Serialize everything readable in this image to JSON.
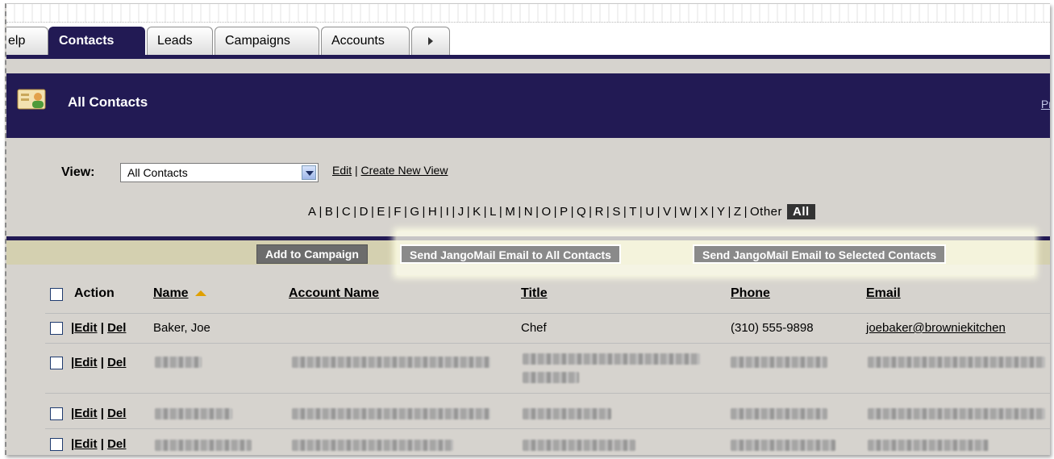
{
  "tabs": [
    {
      "label": "elp",
      "active": false
    },
    {
      "label": "Contacts",
      "active": true
    },
    {
      "label": "Leads",
      "active": false
    },
    {
      "label": "Campaigns",
      "active": false
    },
    {
      "label": "Accounts",
      "active": false
    }
  ],
  "header": {
    "title": "All Contacts",
    "right_link": "Pri"
  },
  "view": {
    "label": "View:",
    "selected": "All Contacts",
    "edit_link": "Edit",
    "separator": "|",
    "create_link": "Create New View"
  },
  "alphabet": [
    "A",
    "B",
    "C",
    "D",
    "E",
    "F",
    "G",
    "H",
    "I",
    "J",
    "K",
    "L",
    "M",
    "N",
    "O",
    "P",
    "Q",
    "R",
    "S",
    "T",
    "U",
    "V",
    "W",
    "X",
    "Y",
    "Z",
    "Other"
  ],
  "alphabet_all": "All",
  "toolbar": {
    "add_to_campaign": "Add to Campaign",
    "send_all": "Send JangoMail Email to All Contacts",
    "send_selected": "Send JangoMail Email to Selected Contacts"
  },
  "table": {
    "headers": {
      "action": "Action",
      "name": "Name",
      "account": "Account Name",
      "title": "Title",
      "phone": "Phone",
      "email": "Email"
    },
    "action_edit": "Edit",
    "action_del": "Del",
    "action_sep": "|",
    "first_row": {
      "name": "Baker, Joe",
      "account": "",
      "title": "Chef",
      "phone": "(310) 555-9898",
      "email": "joebaker@browniekitchen"
    }
  },
  "colors": {
    "nav": "#221a54",
    "toolbar": "#d4d0b0",
    "sort_icon": "#e0a000"
  }
}
